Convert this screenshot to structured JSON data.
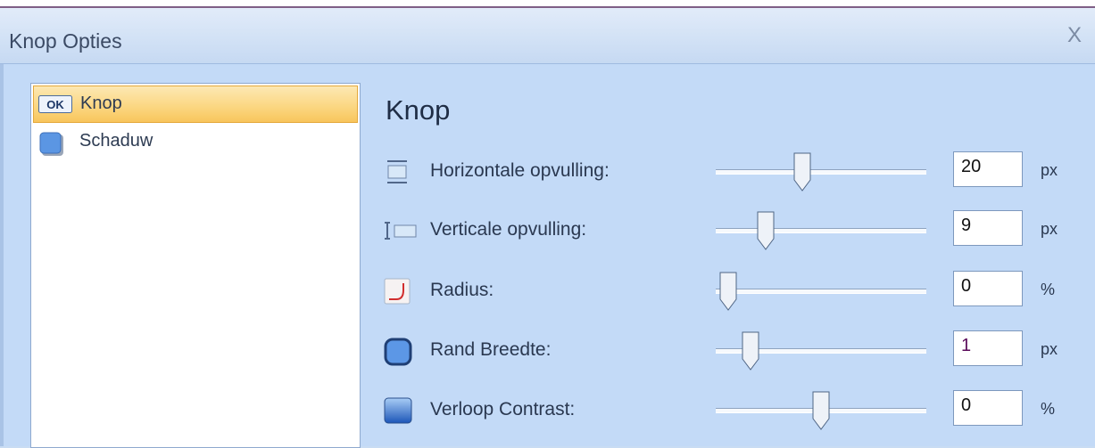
{
  "window": {
    "title": "Knop Opties",
    "close_glyph": "X"
  },
  "sidebar": {
    "items": [
      {
        "label": "Knop",
        "icon": "ok-button-icon",
        "selected": true
      },
      {
        "label": "Schaduw",
        "icon": "shadow-square-icon",
        "selected": false
      }
    ]
  },
  "panel": {
    "heading": "Knop",
    "rows": [
      {
        "label": "Horizontale opvulling:",
        "icon": "horizontal-padding-icon",
        "value": "20",
        "unit": "px",
        "slider_fraction": 0.4
      },
      {
        "label": "Verticale opvulling:",
        "icon": "vertical-padding-icon",
        "value": "9",
        "unit": "px",
        "slider_fraction": 0.2
      },
      {
        "label": "Radius:",
        "icon": "radius-icon",
        "value": "0",
        "unit": "%",
        "slider_fraction": 0.0
      },
      {
        "label": "Rand Breedte:",
        "icon": "border-width-icon",
        "value": "1",
        "unit": "px",
        "slider_fraction": 0.12
      },
      {
        "label": "Verloop Contrast:",
        "icon": "gradient-contrast-icon",
        "value": "0",
        "unit": "%",
        "slider_fraction": 0.5
      }
    ]
  },
  "colors": {
    "selected_item": "#fbd67f",
    "background": "#c3daf7",
    "value_text_rand": "#5a0a5a"
  }
}
